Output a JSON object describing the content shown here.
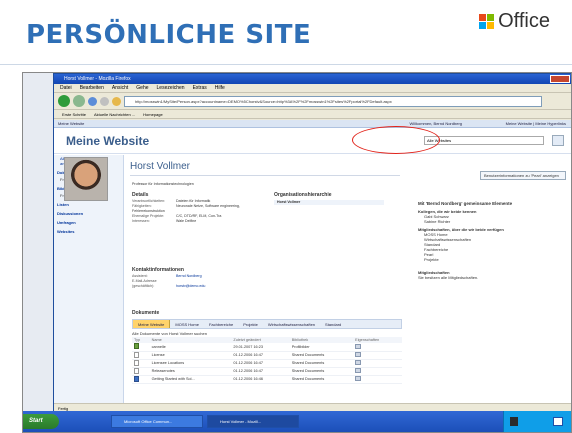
{
  "slide": {
    "title": "PERSÖNLICHE SITE",
    "office_logo_text": "Office",
    "logo_colors": [
      "#e8491b",
      "#7fba00",
      "#00a4ef",
      "#ffb900"
    ]
  },
  "browser": {
    "window_title": "Horst Vollmer - Mozilla Firefox",
    "menu": [
      "Datei",
      "Bearbeiten",
      "Ansicht",
      "Gehe",
      "Lesezeichen",
      "Extras",
      "Hilfe"
    ],
    "address": "http://mosswin1/MySite/Person.aspx?accountname=DEMO%5Chorstv&Source=http%3A%2F%2Fmosswin1%2Fsites%2Fportal%2FDefault.aspx",
    "links": [
      "Erste Schritte",
      "Aktuelle Nachrichten ...",
      "Homepage"
    ],
    "status": "Fertig"
  },
  "sharepoint": {
    "top_left": "Meine Website",
    "user_menu": "Willkommen, Bernd Nordberg",
    "top_right": "Meine Website | Meine Hyperlinks",
    "site_title": "Meine Website",
    "search_scope": "Alle Websites",
    "left_nav": {
      "intro": [
        "Alle Websiteinhalte",
        "anzeigen"
      ],
      "sections": [
        {
          "header": "Dokumente",
          "items": [
            "Freigegebene Dokumente"
          ]
        },
        {
          "header": "Bilder",
          "items": [
            "Freigegebene Bilder"
          ]
        },
        {
          "header": "Listen",
          "items": []
        },
        {
          "header": "Diskussionen",
          "items": []
        },
        {
          "header": "Umfragen",
          "items": []
        },
        {
          "header": "Websites",
          "items": []
        }
      ]
    },
    "person": {
      "name": "Horst Vollmer",
      "job_title": "Professor für Informationstechnologien",
      "info_button": "Benutzerinformationen zu 'Pearl' anzeigen"
    },
    "details": {
      "header": "Details",
      "rows": [
        {
          "k": "Verantwortlichkeiten:",
          "v": "Dateien für Informatik"
        },
        {
          "k": "Fähigkeiten:",
          "v": "Neuronale Netze, Software engineering, Fehlerrekonstruktion"
        },
        {
          "k": "Ehemalige Projekte:",
          "v": "C/C, DTD/RF, ELM, Con-Tra"
        },
        {
          "k": "Interessen:",
          "v": "Wale Delfine"
        }
      ]
    },
    "contact": {
      "header": "Kontaktinformationen",
      "rows": [
        {
          "k": "Assistent:",
          "v": "Bernd Nordberg"
        },
        {
          "k": "E-Mail-Adresse (geschäftlich):",
          "v": "horstv@demo.edu"
        }
      ]
    },
    "org": {
      "header": "Organisationshierarchie",
      "name": "Horst Vollmer"
    },
    "common": {
      "header": "Mit 'Bernd Nordberg' gemeinsame Elemente",
      "colleagues_header": "Kollegen, die wir beide kennen",
      "colleagues": [
        "Gabi Schwarz",
        "Sabine Richter"
      ],
      "memberships_header": "Mitgliedschaften, über die wir beide verfügen",
      "memberships": [
        "MOSS Home",
        "Wirtschaftswissenschaften",
        "Standard",
        "Fachbereiche",
        "Pearl",
        "Projekte"
      ],
      "member_header": "Mitgliedschaften",
      "member_text": "Sie besitzen alle Mitgliedschaften."
    },
    "documents": {
      "header": "Dokumente",
      "tabs": [
        "Meine Website",
        "MOSS Home",
        "Fachbereiche",
        "Projekte",
        "Wirtschaftswissenschaften",
        "Standard"
      ],
      "filter": "Alle Dokumente von Horst Vollmer suchen",
      "columns": [
        "Typ",
        "Name",
        "Zuletzt geändert",
        "Bibliothek",
        "Eigenschaften"
      ],
      "rows": [
        {
          "name": "cannelle",
          "modified": "29.01.2007 16:23",
          "library": "Profilbilder"
        },
        {
          "name": "License",
          "modified": "01.12.2006 16:47",
          "library": "Shared Documents"
        },
        {
          "name": "Licensee Locations",
          "modified": "01.12.2006 16:47",
          "library": "Shared Documents"
        },
        {
          "name": "Releasenotes",
          "modified": "01.12.2006 16:47",
          "library": "Shared Documents"
        },
        {
          "name": "Getting Started with Sol...",
          "modified": "01.12.2006 16:46",
          "library": "Shared Documents"
        }
      ]
    }
  },
  "taskbar": {
    "start": "Start",
    "items": [
      "Microsoft Office Commun...",
      "Horst Vollmer - Mozill..."
    ]
  }
}
